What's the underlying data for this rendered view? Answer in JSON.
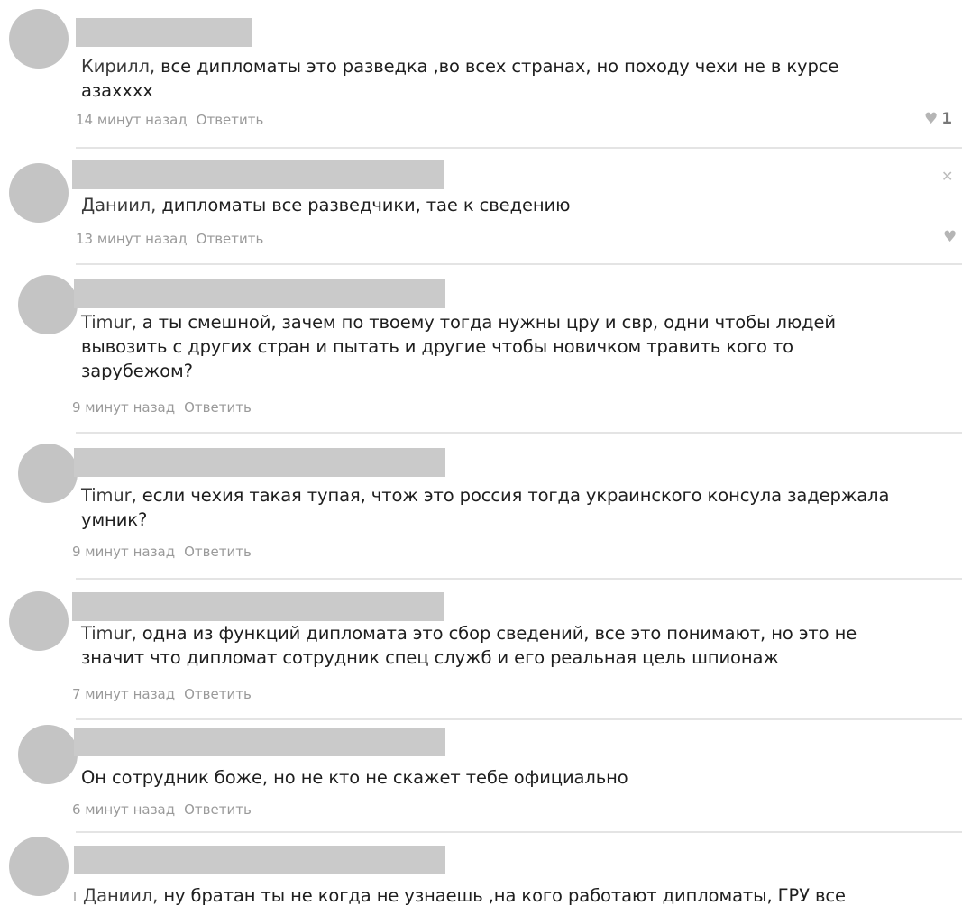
{
  "comments": [
    {
      "author": "Кирилл,",
      "body": " все дипломаты это разведка ,во всех странах, но походу чехи не в курсе\nазахххх",
      "time": "14 минут назад",
      "reply": "Ответить",
      "likes": "1"
    },
    {
      "author": "Даниил,",
      "body": " дипломаты все разведчики, тае к сведению",
      "time": "13 минут назад",
      "reply": "Ответить",
      "likes": ""
    },
    {
      "author": "Timur,",
      "body": " а ты смешной, зачем по твоему тогда нужны цру и свр, одни чтобы людей\nвывозить с других стран и пытать и другие чтобы новичком травить кого то\nзарубежом?",
      "time": "9 минут назад",
      "reply": "Ответить"
    },
    {
      "author": "Timur,",
      "body": " если чехия такая тупая, чтож это россия тогда украинского консула задержала\nумник?",
      "time": "9 минут назад",
      "reply": "Ответить"
    },
    {
      "author": "Timur,",
      "body": " одна из функций дипломата это сбор сведений, все это понимают, но это не\nзначит что дипломат сотрудник спец служб и его реальная цель шпионаж",
      "time": "7 минут назад",
      "reply": "Ответить"
    },
    {
      "author": "",
      "body": "Он сотрудник боже, но не кто не скажет тебе официально",
      "time": "6 минут назад",
      "reply": "Ответить"
    },
    {
      "author": "Даниил,",
      "body": " ну братан ты не когда не узнаешь ,на кого работают дипломаты, ГРУ все"
    }
  ],
  "icons": {
    "like": "heart-icon",
    "close": "close-icon"
  }
}
